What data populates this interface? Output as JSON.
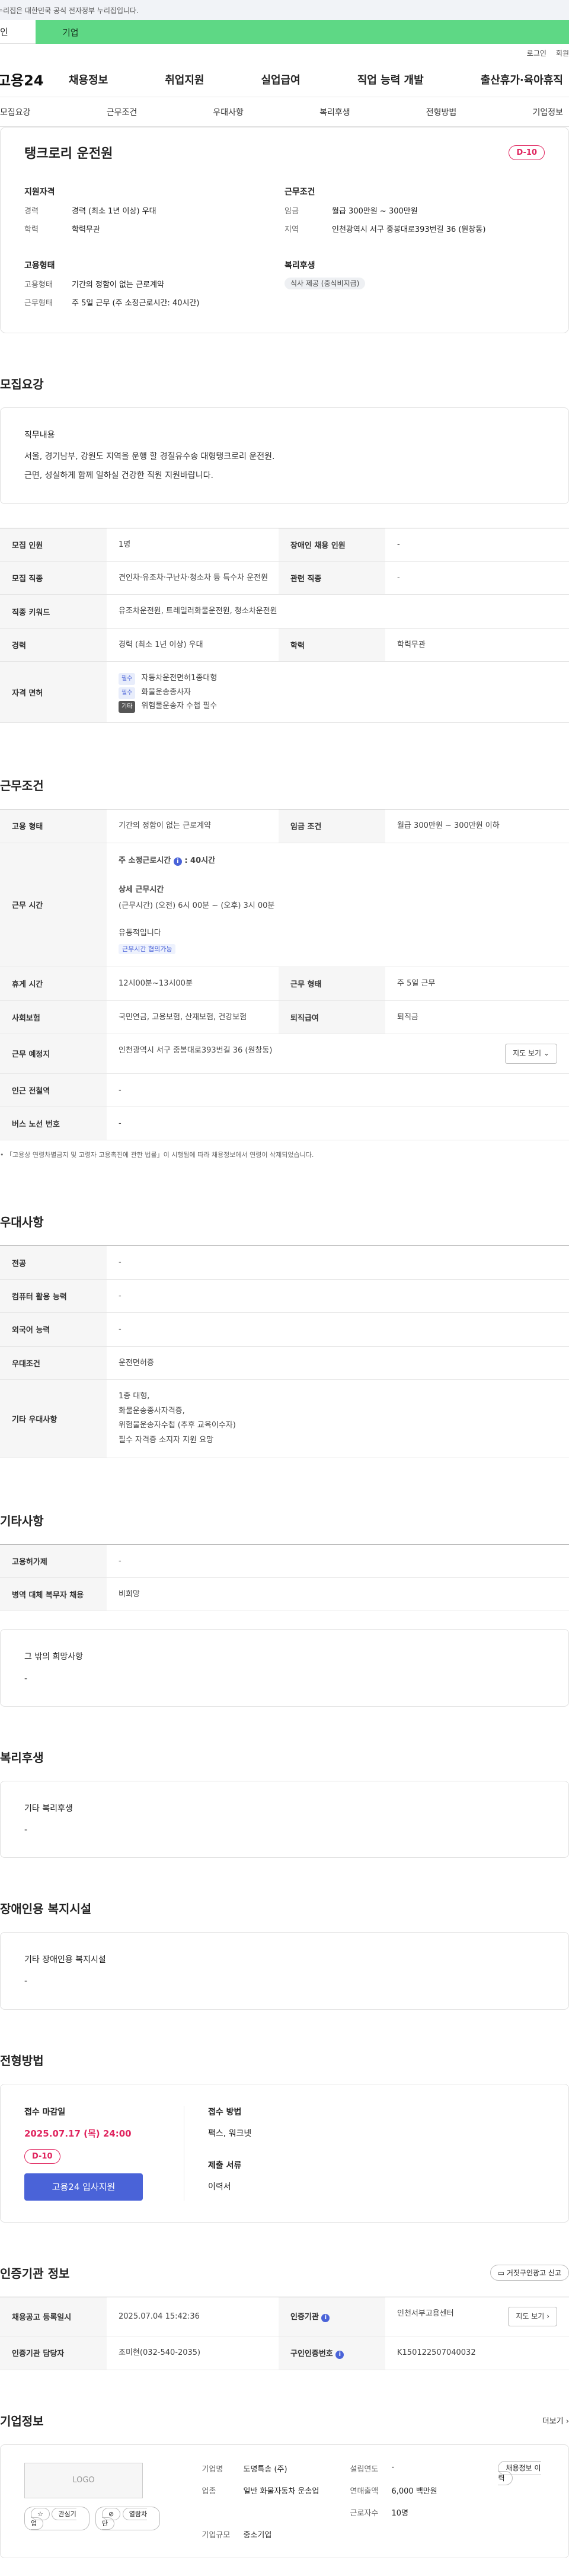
{
  "banner": {
    "text": "누리집은 대한민국 공식 전자정부 누리집입니다."
  },
  "site_tabs": {
    "personal": "인",
    "company": "기업"
  },
  "util": {
    "login": "로그인",
    "join": "회원"
  },
  "gnb": {
    "logo": "고용24",
    "menu": [
      "채용정보",
      "취업지원",
      "실업급여",
      "직업 능력 개발",
      "출산휴가·육아휴직"
    ]
  },
  "anchor_nav": [
    "모집요강",
    "근무조건",
    "우대사항",
    "복리후생",
    "전형방법",
    "기업정보"
  ],
  "summary": {
    "title": "탱크로리 운전원",
    "dday": "D-10",
    "qual": {
      "heading": "지원자격",
      "rows": [
        {
          "k": "경력",
          "v": "경력 (최소 1년 이상) 우대"
        },
        {
          "k": "학력",
          "v": "학력무관"
        }
      ]
    },
    "cond": {
      "heading": "근무조건",
      "rows": [
        {
          "k": "임금",
          "v": "월급 300만원 ~ 300만원"
        },
        {
          "k": "지역",
          "v": "인천광역시 서구 중봉대로393번길 36 (원창동)"
        }
      ]
    },
    "emp": {
      "heading": "고용형태",
      "rows": [
        {
          "k": "고용형태",
          "v": "기간의 정함이 없는 근로계약"
        },
        {
          "k": "근무형태",
          "v": "주 5일 근무 (주 소정근로시간: 40시간)"
        }
      ]
    },
    "welfare": {
      "heading": "복리후생",
      "chip": "식사 제공 (중식비지급)"
    }
  },
  "recruit": {
    "title": "모집요강",
    "duty_label": "직무내용",
    "duty_lines": [
      "서울, 경기남부, 강원도 지역을 운행 할  경질유수송 대형탱크로리 운전원.",
      "근면, 성실하게 함께 일하실 건강한 직원 지원바랍니다."
    ],
    "rows": {
      "count_k": "모집 인원",
      "count_v": "1명",
      "disabled_k": "장애인 채용 인원",
      "disabled_v": "-",
      "job_k": "모집 직종",
      "job_v": "견인차·유조차·구난차·청소차 등 특수차 운전원",
      "rel_k": "관련 직종",
      "rel_v": "-",
      "kw_k": "직종 키워드",
      "kw_v": "유조차운전원, 트레일러화물운전원, 청소차운전원",
      "career_k": "경력",
      "career_v": "경력 (최소 1년 이상) 우대",
      "edu_k": "학력",
      "edu_v": "학력무관",
      "lic_k": "자격 면허",
      "licenses": [
        {
          "tag": "필수",
          "name": "자동차운전면허1종대형"
        },
        {
          "tag": "필수",
          "name": "화물운송종사자"
        },
        {
          "tag": "기타",
          "name": "위험물운송자 수첩 필수"
        }
      ]
    }
  },
  "work": {
    "title": "근무조건",
    "emp_k": "고용 형태",
    "emp_v": "기간의 정함이 없는 근로계약",
    "wage_k": "임금 조건",
    "wage_v": "월급 300만원 ~ 300만원 이하",
    "hours_k": "근무 시간",
    "hours_week": "주 소정근로시간",
    "hours_week_v": ": 40시간",
    "hours_detail_label": "상세 근무시간",
    "hours_detail": "(근무시간) (오전) 6시 00분 ~ (오후) 3시 00분",
    "hours_flex": "유동적입니다",
    "hours_link": "근무시간 협의가능",
    "rest_k": "휴게 시간",
    "rest_v": "12시00분~13시00분",
    "form_k": "근무 형태",
    "form_v": "주 5일 근무",
    "ins_k": "사회보험",
    "ins_v": "국민연금, 고용보험, 산재보험, 건강보험",
    "sev_k": "퇴직급여",
    "sev_v": "퇴직금",
    "loc_k": "근무 예정지",
    "loc_v": "인천광역시 서구 중봉대로393번길 36 (원창동)",
    "map_btn": "지도 보기",
    "subway_k": "인근 전철역",
    "subway_v": "-",
    "bus_k": "버스 노선 번호",
    "bus_v": "-",
    "note": "「고용상 연령차별금지 및 고령자 고용촉진에 관한 법률」이 시행됨에 따라 채용정보에서 연령이 삭제되었습니다."
  },
  "pref": {
    "title": "우대사항",
    "major_k": "전공",
    "major_v": "-",
    "pc_k": "컴퓨터 활용 능력",
    "pc_v": "-",
    "lang_k": "외국어 능력",
    "lang_v": "-",
    "cond_k": "우대조건",
    "cond_v": "운전면허증",
    "etc_k": "기타 우대사항",
    "etc_lines": [
      "1종 대형,",
      "화물운송종사자격증,",
      "위험물운송자수첩 (추후 교육이수자)",
      "필수 자격증  소지자 지원 요망"
    ]
  },
  "other": {
    "title": "기타사항",
    "ex_k": "고용허가제",
    "ex_v": "-",
    "mil_k": "병역 대체 복무자 채용",
    "mil_v": "비희망",
    "hope_label": "그 밖의 희망사항",
    "hope_v": "-"
  },
  "welfare": {
    "title": "복리후생",
    "label": "기타 복리후생",
    "value": "-"
  },
  "disabled_fac": {
    "title": "장애인용 복지시설",
    "label": "기타 장애인용 복지시설",
    "value": "-"
  },
  "process": {
    "title": "전형방법",
    "deadline_label": "접수 마감일",
    "deadline": "2025.07.17 (목) 24:00",
    "dday": "D-10",
    "apply_btn": "고용24 입사지원",
    "method_label": "접수 방법",
    "method_v": "팩스, 워크넷",
    "docs_label": "제출 서류",
    "docs_v": "이력서"
  },
  "agency": {
    "title": "인증기관 정보",
    "report_btn": "거짓구인광고 신고",
    "reg_k": "채용공고 등록일시",
    "reg_v": "2025.07.04 15:42:36",
    "org_k": "인증기관",
    "org_v": "인천서부고용센터",
    "map_btn": "지도 보기",
    "mgr_k": "인증기관 담당자",
    "mgr_v": "조미현(032-540-2035)",
    "id_k": "구인인증번호",
    "id_v": "K150122507040032"
  },
  "companyinfo": {
    "title": "기업정보",
    "more": "더보기",
    "logo": "LOGO",
    "fav": "관심기업",
    "block": "열람차단",
    "prev_btn": "채용정보 이력",
    "name_k": "기업명",
    "name_v": "도명특송 (주)",
    "year_k": "설립연도",
    "year_v": "-",
    "ind_k": "업종",
    "ind_v": "일반 화물자동차 운송업",
    "sales_k": "연매출액",
    "sales_v": "6,000 백만원",
    "emp_k": "근로자수",
    "emp_v": "10명",
    "size_k": "기업규모",
    "size_v": "중소기업"
  }
}
